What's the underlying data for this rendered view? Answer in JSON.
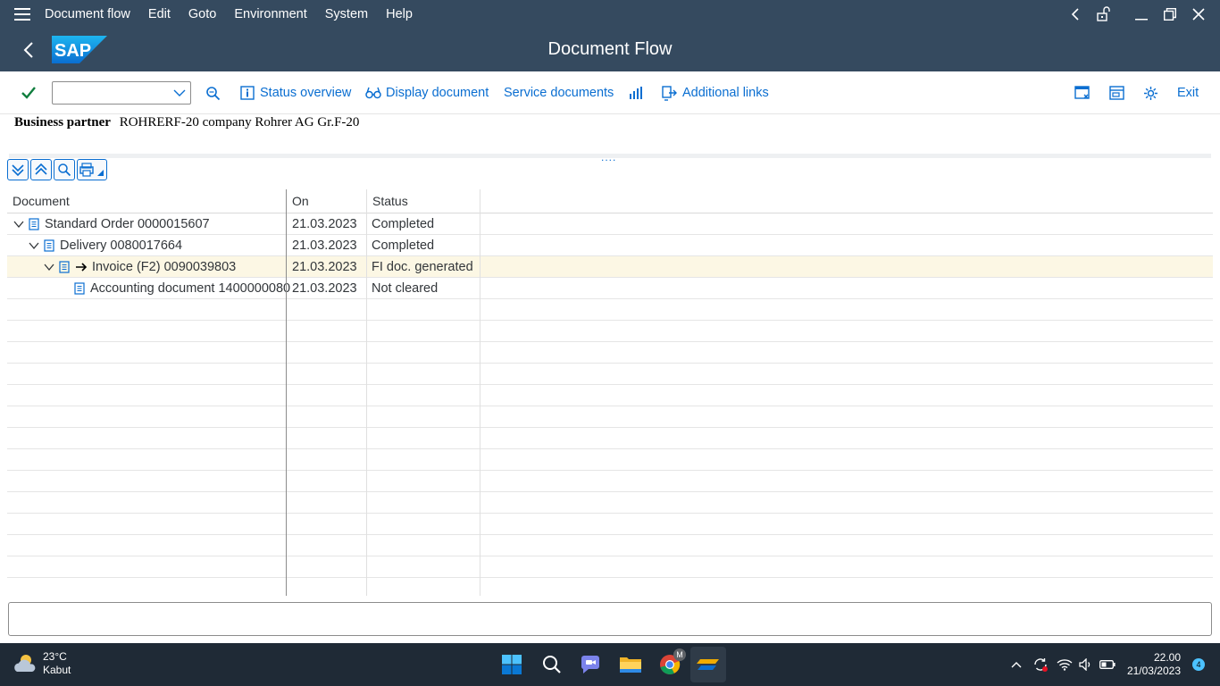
{
  "menubar": {
    "items": [
      "Document flow",
      "Edit",
      "Goto",
      "Environment",
      "System",
      "Help"
    ]
  },
  "titlebar": {
    "title": "Document Flow",
    "logo_text": "SAP"
  },
  "toolbar": {
    "command_value": "",
    "status_overview": "Status overview",
    "display_document": "Display document",
    "service_documents": "Service documents",
    "additional_links": "Additional links",
    "exit": "Exit"
  },
  "header": {
    "bp_label": "Business partner",
    "bp_value": "ROHRERF-20 company Rohrer AG Gr.F-20",
    "splitter_dots": "...."
  },
  "grid": {
    "columns": [
      "Document",
      "On",
      "Status"
    ],
    "rows": [
      {
        "document": "Standard Order 0000015607",
        "on": "21.03.2023",
        "status": "Completed",
        "level": 0,
        "expanded": true
      },
      {
        "document": "Delivery 0080017664",
        "on": "21.03.2023",
        "status": "Completed",
        "level": 1,
        "expanded": true
      },
      {
        "document": "Invoice (F2) 0090039803",
        "on": "21.03.2023",
        "status": "FI doc. generated",
        "level": 2,
        "expanded": true,
        "selected": true
      },
      {
        "document": "Accounting document 1400000080",
        "on": "21.03.2023",
        "status": "Not cleared",
        "level": 3,
        "expanded": false
      }
    ]
  },
  "taskbar": {
    "temperature": "23°C",
    "weather": "Kabut",
    "time": "22.00",
    "date": "21/03/2023",
    "notifications": "4",
    "chrome_badge": "M"
  },
  "colors": {
    "shell": "#354a5f",
    "accent": "#0a6ed1",
    "selected_row": "#fcf7e4",
    "check": "#107e3e"
  }
}
